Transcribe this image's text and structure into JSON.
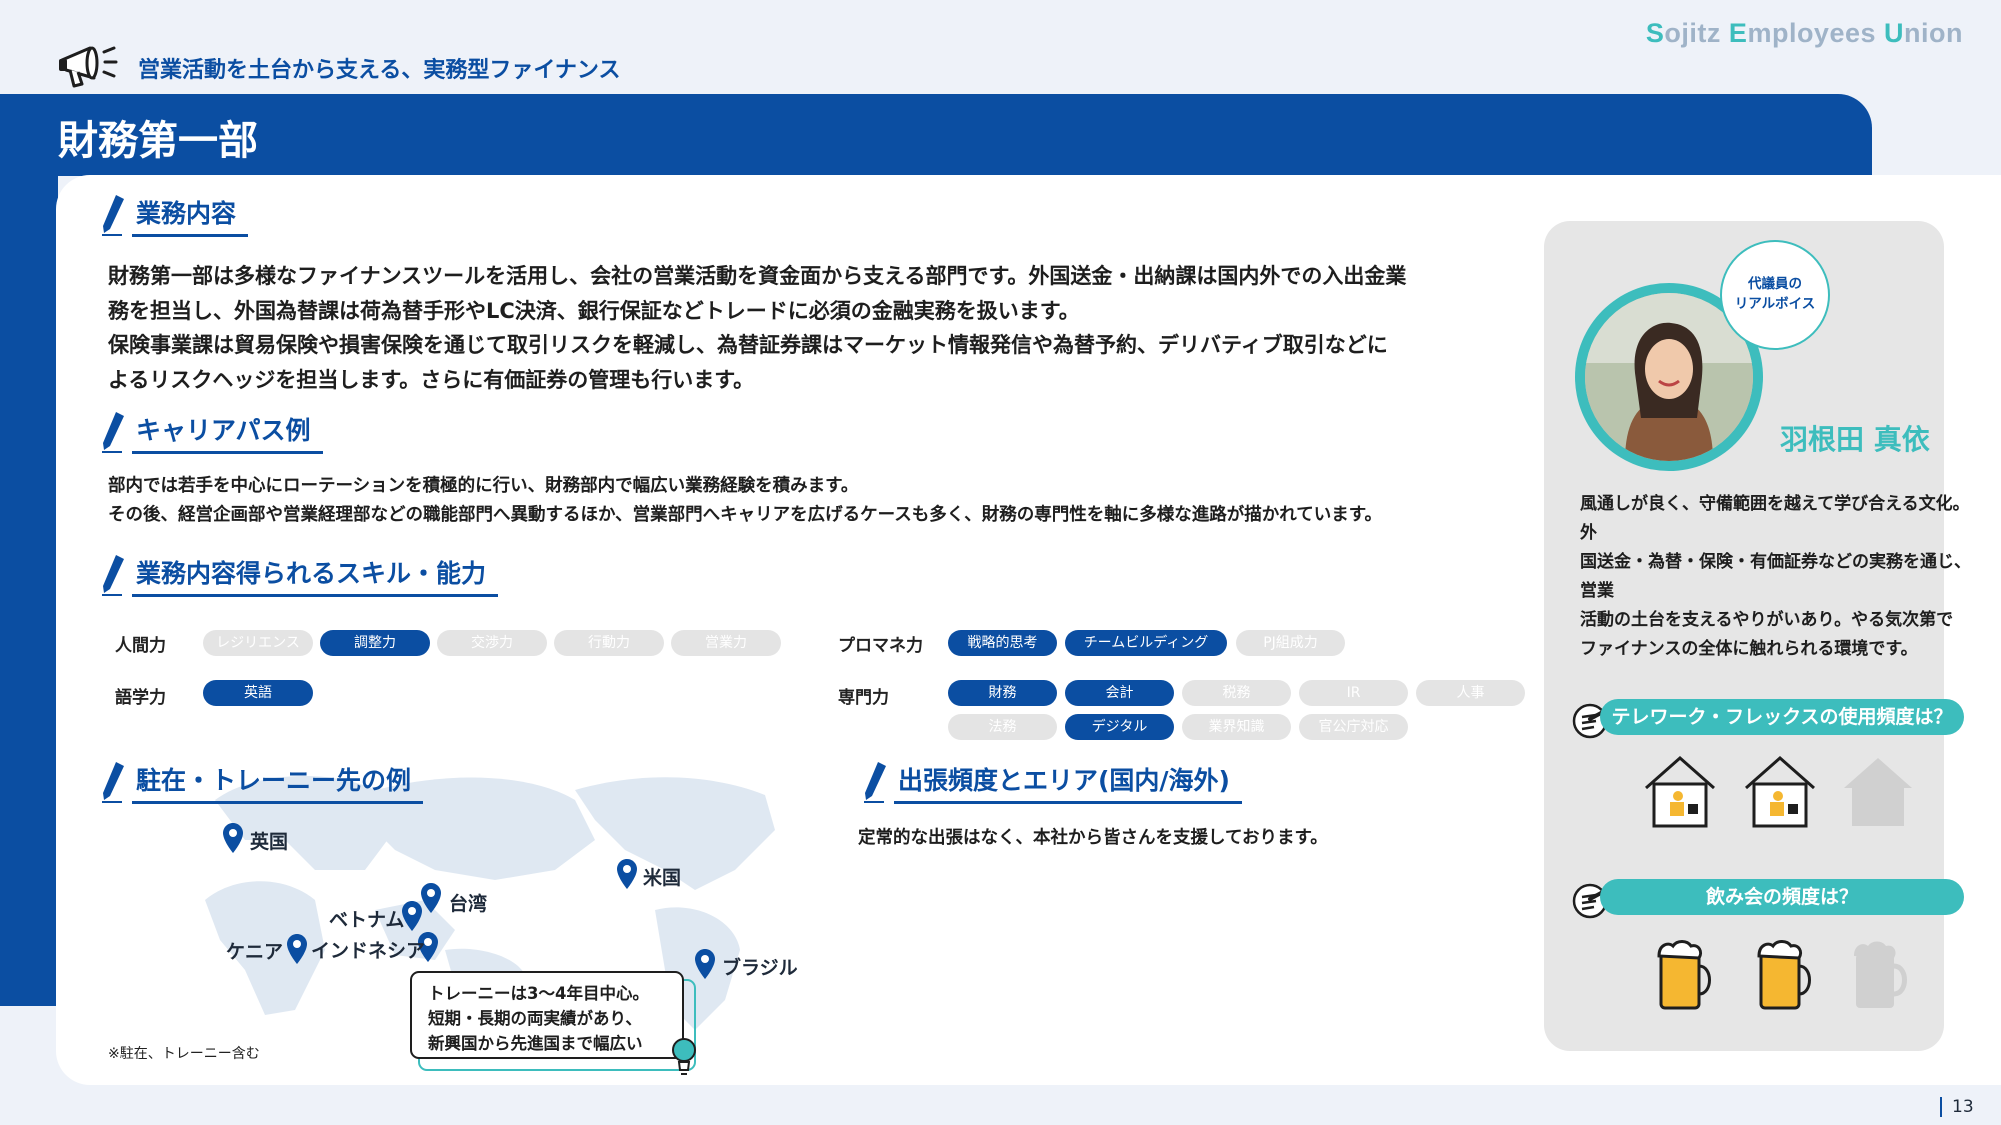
{
  "header": {
    "brand_words": [
      "Sojitz",
      "Employees",
      "Union"
    ],
    "tagline": "営業活動を土台から支える、実務型ファイナンス",
    "page_title": "財務第一部"
  },
  "sections": {
    "duties": {
      "heading": "業務内容",
      "lines": [
        "財務第一部は多様なファイナンスツールを活用し、会社の営業活動を資金面から支える部門です。外国送金・出納課は国内外での入出金業",
        "務を担当し、外国為替課は荷為替手形やLC決済、銀行保証などトレードに必須の金融実務を扱います。",
        "保険事業課は貿易保険や損害保険を通じて取引リスクを軽減し、為替証券課はマーケット情報発信や為替予約、デリバティブ取引などに",
        "よるリスクヘッジを担当します。さらに有価証券の管理も行います。"
      ]
    },
    "career": {
      "heading": "キャリアパス例",
      "lines": [
        "部内では若手を中心にローテーションを積極的に行い、財務部内で幅広い業務経験を積みます。",
        "その後、経営企画部や営業経理部などの職能部門へ異動するほか、営業部門へキャリアを広げるケースも多く、財務の専門性を軸に多様な進路が描かれています。"
      ]
    },
    "skills": {
      "heading": "業務内容得られるスキル・能力",
      "groups": [
        {
          "label": "人間力",
          "items": [
            {
              "text": "レジリエンス",
              "on": false
            },
            {
              "text": "調整力",
              "on": true
            },
            {
              "text": "交渉力",
              "on": false
            },
            {
              "text": "行動力",
              "on": false
            },
            {
              "text": "営業力",
              "on": false
            }
          ]
        },
        {
          "label": "語学力",
          "items": [
            {
              "text": "英語",
              "on": true
            }
          ]
        },
        {
          "label": "プロマネ力",
          "items": [
            {
              "text": "戦略的思考",
              "on": true
            },
            {
              "text": "チームビルディング",
              "on": true
            },
            {
              "text": "PJ組成力",
              "on": false
            }
          ]
        },
        {
          "label": "専門力",
          "items": [
            {
              "text": "財務",
              "on": true
            },
            {
              "text": "会計",
              "on": true
            },
            {
              "text": "税務",
              "on": false
            },
            {
              "text": "IR",
              "on": false
            },
            {
              "text": "人事",
              "on": false
            },
            {
              "text": "法務",
              "on": false
            },
            {
              "text": "デジタル",
              "on": true
            },
            {
              "text": "業界知識",
              "on": false
            },
            {
              "text": "官公庁対応",
              "on": false
            }
          ]
        }
      ]
    },
    "overseas": {
      "heading": "駐在・トレーニー先の例",
      "countries": [
        "英国",
        "米国",
        "台湾",
        "ベトナム",
        "ケニア",
        "インドネシア",
        "ブラジル"
      ],
      "callout": [
        "トレーニーは3～4年目中心。",
        "短期・長期の両実績があり、",
        "新興国から先進国まで幅広い"
      ],
      "note": "※駐在、トレーニー含む"
    },
    "travel": {
      "heading": "出張頻度とエリア(国内/海外)",
      "text": "定常的な出張はなく、本社から皆さんを支援しております。"
    }
  },
  "profile": {
    "bubble": [
      "代議員の",
      "リアルボイス"
    ],
    "name": "羽根田 真依",
    "voice": [
      "風通しが良く、守備範囲を越えて学び合える文化。外",
      "国送金・為替・保険・有価証券などの実務を通じ、営業",
      "活動の土台を支えるやりがいあり。やる気次第で",
      "ファイナンスの全体に触れられる環境です。"
    ],
    "telework_question": "テレワーク・フレックスの使用頻度は？",
    "telework_level": 2,
    "telework_max": 3,
    "drinking_question": "飲み会の頻度は？",
    "drinking_level": 2,
    "drinking_max": 3
  },
  "footer": {
    "page_number": "13"
  },
  "colors": {
    "primary": "#0b4ea2",
    "accent": "#3dbdbd",
    "inactive": "#e4e4e4"
  }
}
